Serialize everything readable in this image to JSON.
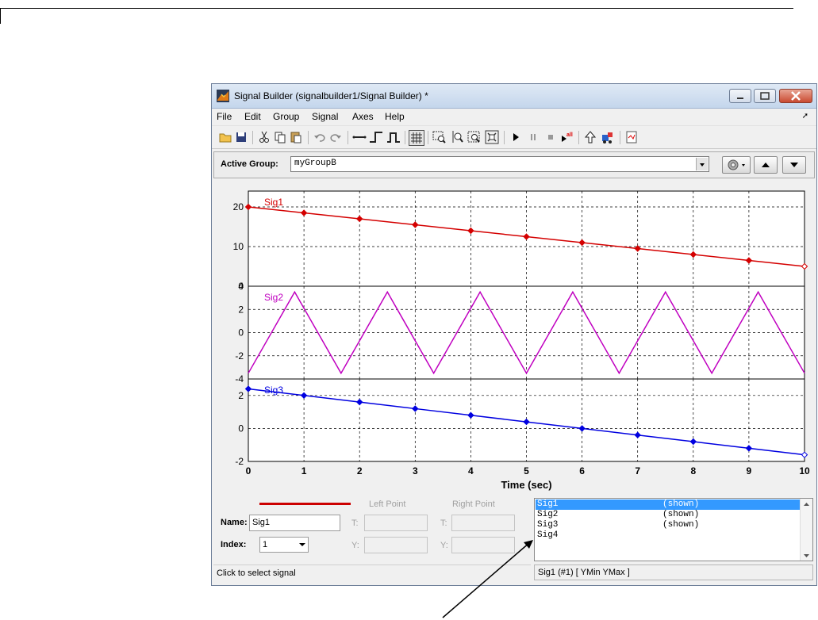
{
  "window": {
    "title": "Signal Builder (signalbuilder1/Signal Builder) *"
  },
  "menu": {
    "items": [
      "File",
      "Edit",
      "Group",
      "Signal",
      "Axes",
      "Help"
    ]
  },
  "toolbar": {
    "icons": [
      "open-icon",
      "save-icon",
      "cut-icon",
      "copy-icon",
      "paste-icon",
      "undo-icon",
      "redo-icon",
      "constant-icon",
      "step-icon",
      "pulse-icon",
      "grid-icon",
      "zoom-x-icon",
      "zoom-y-icon",
      "zoom-xy-icon",
      "fit-icon",
      "play-icon",
      "pause-icon",
      "stop-icon",
      "play-all-icon",
      "up-icon",
      "model-icon",
      "report-icon"
    ]
  },
  "group": {
    "label": "Active Group:",
    "value": "myGroupB"
  },
  "chart_data": {
    "type": "line",
    "xlabel": "Time (sec)",
    "xlim": [
      0,
      10
    ],
    "xticks": [
      "0",
      "1",
      "2",
      "3",
      "4",
      "5",
      "6",
      "7",
      "8",
      "9",
      "10"
    ],
    "grid": true,
    "panels": [
      {
        "name": "Sig1",
        "color": "#d40000",
        "ylim": [
          0,
          24
        ],
        "yticks": [
          0,
          10,
          20
        ],
        "x": [
          0,
          1,
          2,
          3,
          4,
          5,
          6,
          7,
          8,
          9,
          10
        ],
        "y": [
          20,
          18.5,
          17,
          15.5,
          14,
          12.5,
          11,
          9.5,
          8,
          6.5,
          5
        ],
        "markers": true
      },
      {
        "name": "Sig2",
        "color": "#c000c0",
        "ylim": [
          -4,
          4
        ],
        "yticks": [
          -4,
          -2,
          0,
          2,
          4
        ],
        "x": [
          0,
          0.833,
          1.667,
          2.5,
          3.333,
          4.167,
          5,
          5.833,
          6.667,
          7.5,
          8.333,
          9.167,
          10
        ],
        "y": [
          -3.5,
          3.5,
          -3.5,
          3.5,
          -3.5,
          3.5,
          -3.5,
          3.5,
          -3.5,
          3.5,
          -3.5,
          3.5,
          -3.5
        ],
        "markers": false
      },
      {
        "name": "Sig3",
        "color": "#0000e0",
        "ylim": [
          -2,
          3
        ],
        "yticks": [
          -2,
          0,
          2
        ],
        "x": [
          0,
          1,
          2,
          3,
          4,
          5,
          6,
          7,
          8,
          9,
          10
        ],
        "y": [
          2.4,
          2,
          1.6,
          1.2,
          0.8,
          0.4,
          0,
          -0.4,
          -0.8,
          -1.2,
          -1.6
        ],
        "markers": true
      }
    ]
  },
  "props": {
    "line_color": "#cc0000",
    "left_point": "Left Point",
    "right_point": "Right Point",
    "name_label": "Name:",
    "name_value": "Sig1",
    "index_label": "Index:",
    "index_value": "1",
    "t_label": "T:",
    "y_label": "Y:"
  },
  "signal_list": [
    {
      "name": "Sig1",
      "status": "(shown)",
      "selected": true
    },
    {
      "name": "Sig2",
      "status": "(shown)",
      "selected": false
    },
    {
      "name": "Sig3",
      "status": "(shown)",
      "selected": false
    },
    {
      "name": "Sig4",
      "status": "",
      "selected": false
    }
  ],
  "status": {
    "left": "Click to select signal",
    "right": "Sig1 (#1)  [ YMin YMax ]"
  }
}
